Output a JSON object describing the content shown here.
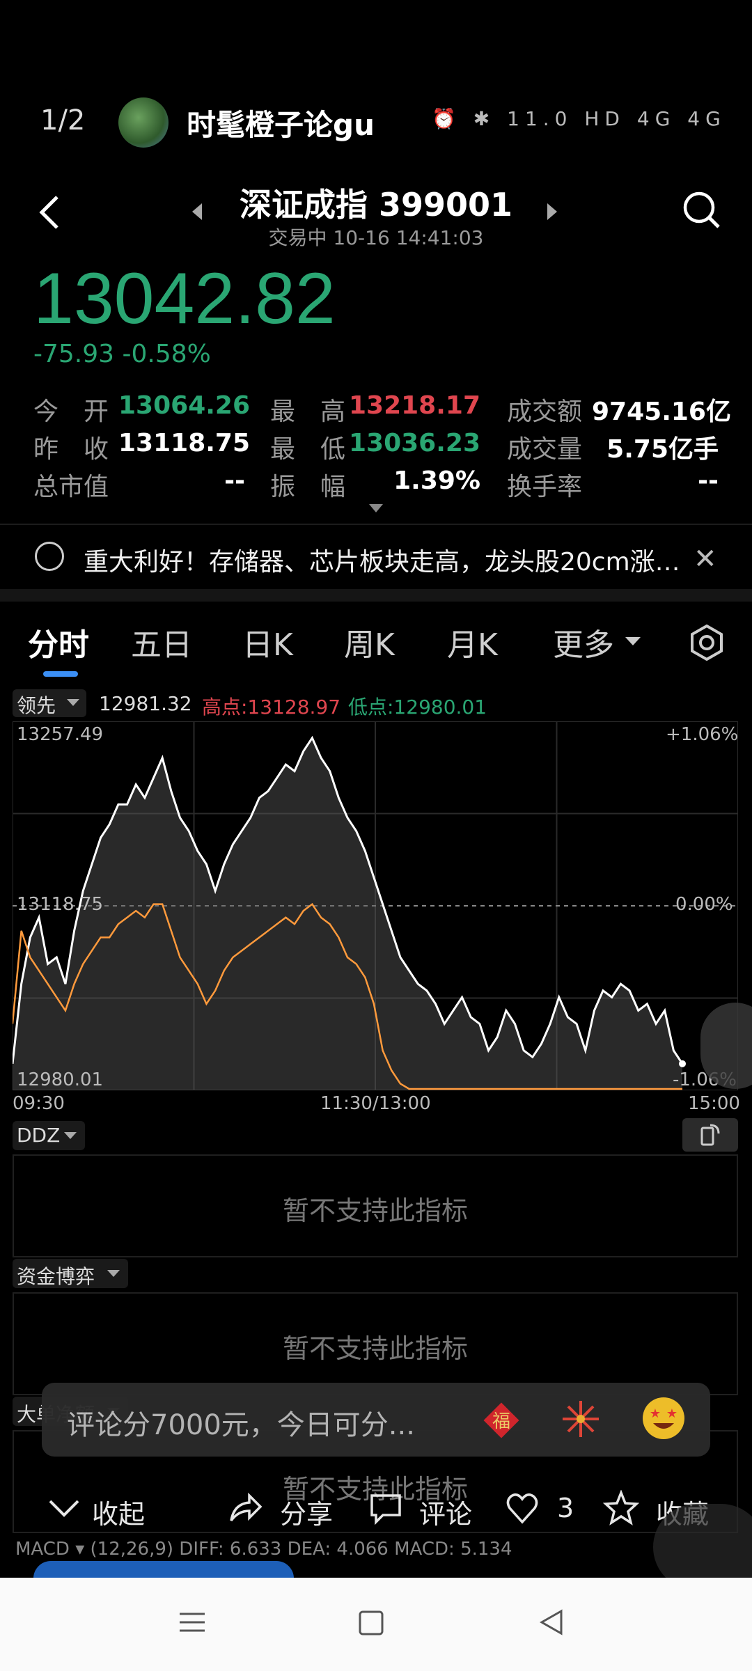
{
  "header": {
    "pager": "1/2",
    "username": "时髦橙子论gu",
    "status_text": "⏰ ✱ 11.0 HD 4G 4G"
  },
  "stock": {
    "name": "深证成指 399001",
    "trade_status": "交易中 10-16 14:41:03",
    "price": "13042.82",
    "change": "-75.93  -0.58%"
  },
  "stats": {
    "open_label": "今　开",
    "open": "13064.26",
    "high_label": "最　高",
    "high": "13218.17",
    "amount_label": "成交额",
    "amount": "9745.16亿",
    "prev_label": "昨　收",
    "prev": "13118.75",
    "low_label": "最　低",
    "low": "13036.23",
    "volume_label": "成交量",
    "volume": "5.75亿手",
    "mcap_label": "总市值",
    "mcap": "--",
    "amp_label": "振　幅",
    "amp": "1.39%",
    "turnover_label": "换手率",
    "turnover": "--"
  },
  "news": {
    "text": "重大利好！存储器、芯片板块走高，龙头股20cm涨…"
  },
  "tabs": [
    "分时",
    "五日",
    "日K",
    "周K",
    "月K",
    "更多"
  ],
  "chart_header": {
    "lead_label": "领先",
    "current": "12981.32",
    "high": "高点:13128.97",
    "low": "低点:12980.01"
  },
  "chart_data": {
    "type": "line",
    "y_top_label": "13257.49",
    "y_mid_label": "13118.75",
    "y_bottom_label": "12980.01",
    "pct_top": "+1.06%",
    "pct_mid": "0.00%",
    "pct_bottom": "-1.06%",
    "x_labels": [
      "09:30",
      "11:30/13:00",
      "15:00"
    ],
    "ylim": [
      12980.01,
      13257.49
    ],
    "series": [
      {
        "color": "#ffffff",
        "values": [
          13000,
          13060,
          13095,
          13110,
          13075,
          13080,
          13060,
          13100,
          13130,
          13150,
          13170,
          13180,
          13195,
          13195,
          13210,
          13200,
          13215,
          13230,
          13205,
          13185,
          13175,
          13160,
          13150,
          13130,
          13150,
          13165,
          13175,
          13185,
          13200,
          13205,
          13215,
          13225,
          13220,
          13235,
          13245,
          13230,
          13220,
          13200,
          13185,
          13175,
          13160,
          13140,
          13120,
          13100,
          13080,
          13070,
          13060,
          13055,
          13045,
          13030,
          13040,
          13050,
          13035,
          13030,
          13010,
          13020,
          13040,
          13030,
          13010,
          13005,
          13015,
          13030,
          13050,
          13035,
          13030,
          13010,
          13040,
          13055,
          13050,
          13060,
          13055,
          13040,
          13045,
          13030,
          13040,
          13010,
          13000
        ]
      },
      {
        "color": "#ff9a3c",
        "values": [
          13030,
          13100,
          13080,
          13070,
          13060,
          13050,
          13040,
          13060,
          13075,
          13085,
          13095,
          13095,
          13105,
          13110,
          13115,
          13110,
          13120,
          13120,
          13100,
          13080,
          13070,
          13060,
          13045,
          13055,
          13070,
          13080,
          13085,
          13090,
          13095,
          13100,
          13105,
          13110,
          13105,
          13115,
          13120,
          13110,
          13105,
          13095,
          13080,
          13075,
          13065,
          13045,
          13010,
          12995,
          12985,
          12975,
          12970,
          12965,
          12960,
          12955,
          12958,
          12965,
          12960,
          12955,
          12950,
          12952,
          12960,
          12955,
          12948,
          12945,
          12950,
          12960,
          12970,
          12960,
          12955,
          12950,
          12965,
          12975,
          12970,
          12978,
          12972,
          12962,
          12966,
          12955,
          12960,
          12948,
          12940
        ]
      }
    ]
  },
  "indicators": {
    "ddz": "DDZ",
    "capital": "资金博弈",
    "bigorder": "大单净额",
    "unsupported": "暂不支持此指标",
    "macd": "MACD ▾   (12,26,9)   DIFF: 6.633   DEA: 4.066   MACD: 5.134"
  },
  "comment": {
    "placeholder": "评论分7000元，今日可分..."
  },
  "actions": {
    "collapse": "收起",
    "share": "分享",
    "comment": "评论",
    "likes": "3",
    "favorite": "收藏"
  },
  "colors": {
    "up": "#e0464f",
    "down": "#2aa673",
    "accent": "#3b8ff5"
  }
}
